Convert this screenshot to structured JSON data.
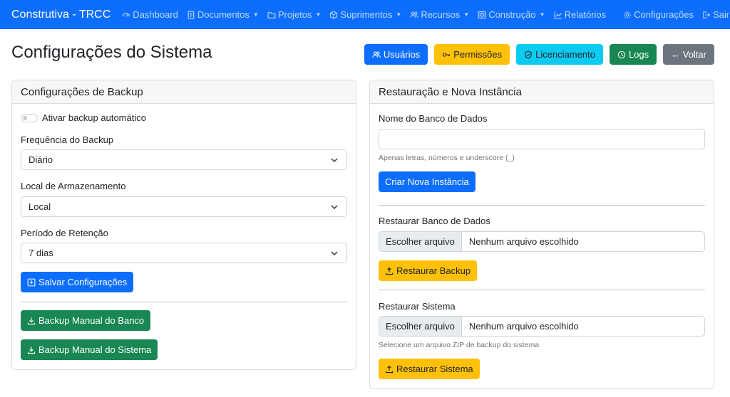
{
  "navbar": {
    "brand": "Construtiva - TRCC",
    "items": [
      {
        "label": "Dashboard",
        "icon": "speedometer-icon",
        "dropdown": false
      },
      {
        "label": "Documentos",
        "icon": "document-icon",
        "dropdown": true
      },
      {
        "label": "Projetos",
        "icon": "folder-icon",
        "dropdown": true
      },
      {
        "label": "Suprimentos",
        "icon": "box-icon",
        "dropdown": true
      },
      {
        "label": "Recursos",
        "icon": "people-icon",
        "dropdown": true
      },
      {
        "label": "Construção",
        "icon": "bricks-icon",
        "dropdown": true
      },
      {
        "label": "Relatórios",
        "icon": "chart-line-icon",
        "dropdown": false
      }
    ],
    "right": [
      {
        "label": "Configurações",
        "icon": "gear-icon"
      },
      {
        "label": "Sair",
        "icon": "logout-icon"
      }
    ]
  },
  "page": {
    "title": "Configurações do Sistema",
    "actions": {
      "users": "Usuários",
      "permissions": "Permissões",
      "licensing": "Licenciamento",
      "logs": "Logs",
      "back": "← Voltar"
    }
  },
  "backup": {
    "header": "Configurações de Backup",
    "auto_backup_label": "Ativar backup automático",
    "auto_backup_enabled": false,
    "frequency_label": "Frequência do Backup",
    "frequency_value": "Diário",
    "storage_label": "Local de Armazenamento",
    "storage_value": "Local",
    "retention_label": "Período de Retenção",
    "retention_value": "7 dias",
    "save_button": "Salvar Configurações",
    "manual_db_button": "Backup Manual do Banco",
    "manual_system_button": "Backup Manual do Sistema"
  },
  "restore": {
    "header": "Restauração e Nova Instância",
    "db_name_label": "Nome do Banco de Dados",
    "db_name_value": "",
    "db_name_help": "Apenas letras, números e underscore (_)",
    "create_button": "Criar Nova Instância",
    "restore_db_label": "Restaurar Banco de Dados",
    "choose_file": "Escolher arquivo",
    "no_file": "Nenhum arquivo escolhido",
    "restore_db_button": "Restaurar Backup",
    "restore_system_label": "Restaurar Sistema",
    "restore_system_help": "Selecione um arquivo ZIP de backup do sistema",
    "restore_system_button": "Restaurar Sistema"
  }
}
